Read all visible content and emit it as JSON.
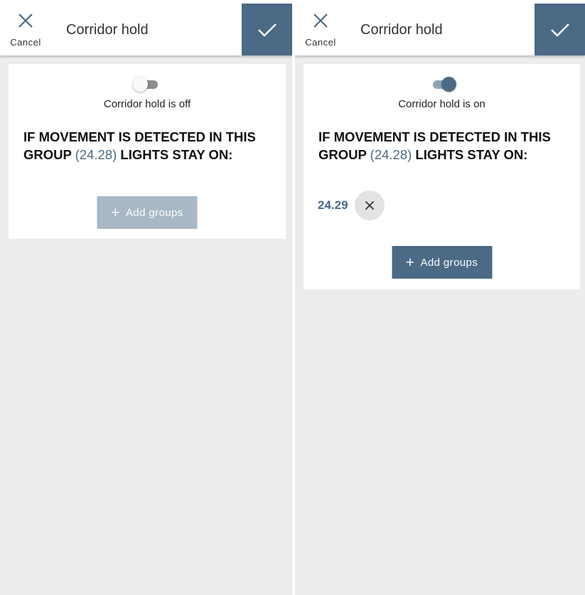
{
  "screens": [
    {
      "header": {
        "cancel_label": "Cancel",
        "title": "Corridor hold"
      },
      "toggle_on": false,
      "status": "Corridor hold is off",
      "heading": {
        "part1": "IF MOVEMENT IS DETECTED IN THIS GROUP ",
        "group_id": "(24.28)",
        "part2": " LIGHTS STAY ON:"
      },
      "selected_groups": [],
      "add_groups": {
        "plus": "+",
        "label": "Add groups",
        "enabled": false
      }
    },
    {
      "header": {
        "cancel_label": "Cancel",
        "title": "Corridor hold"
      },
      "toggle_on": true,
      "status": "Corridor hold is on",
      "heading": {
        "part1": "IF MOVEMENT IS DETECTED IN THIS GROUP ",
        "group_id": "(24.28)",
        "part2": " LIGHTS STAY ON:"
      },
      "selected_groups": [
        {
          "label": "24.29"
        }
      ],
      "add_groups": {
        "plus": "+",
        "label": "Add groups",
        "enabled": true
      }
    }
  ],
  "icons": {
    "cancel": "close-icon",
    "confirm": "checkmark-icon",
    "remove": "close-icon",
    "add": "plus-icon"
  },
  "colors": {
    "accent": "#4b6a85",
    "accent_disabled": "#a9b8c6",
    "background": "#ececec",
    "card": "#ffffff"
  }
}
